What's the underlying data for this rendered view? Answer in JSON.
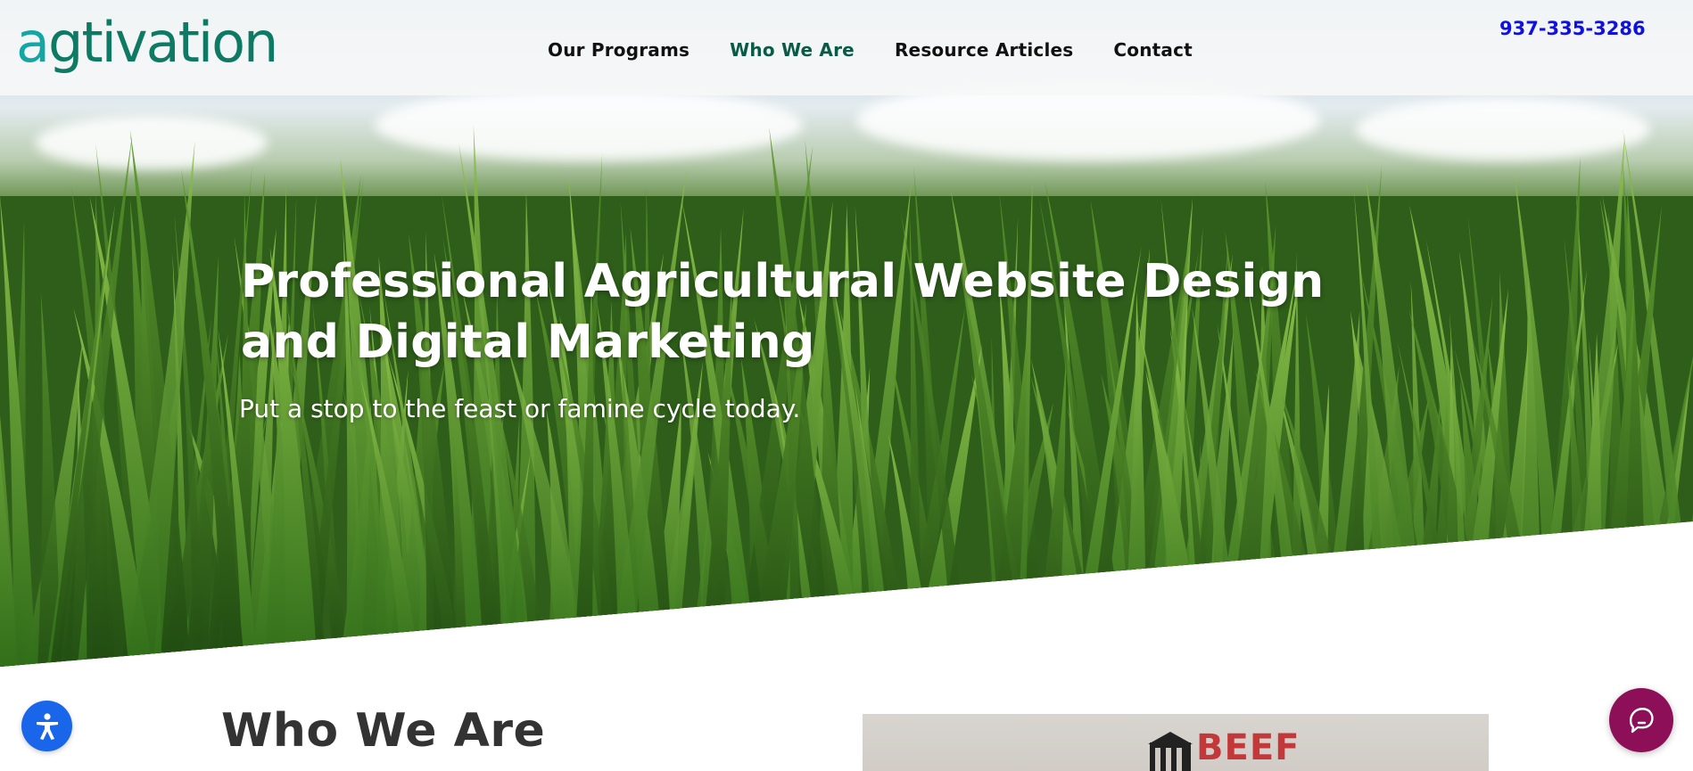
{
  "header": {
    "logo_text": "agtivation",
    "nav": [
      {
        "label": "Our Programs",
        "active": false
      },
      {
        "label": "Who We Are",
        "active": true
      },
      {
        "label": "Resource Articles",
        "active": false
      },
      {
        "label": "Contact",
        "active": false
      }
    ],
    "phone": "937-335-3286"
  },
  "hero": {
    "title": "Professional Agricultural Website Design and Digital Marketing",
    "subtitle": "Put a stop to the feast or famine cycle today."
  },
  "section": {
    "heading": "Who We Are",
    "image_sign_text": "BEEF"
  },
  "floating": {
    "accessibility_icon": "accessibility-icon",
    "chat_icon": "chat-bubble-icon"
  },
  "colors": {
    "brand_teal": "#13a6a4",
    "brand_green": "#0e7a63",
    "nav_active": "#0b5a48",
    "phone_link": "#1010e0",
    "accessibility_blue": "#1a66ea",
    "chat_magenta": "#8c0f58"
  }
}
